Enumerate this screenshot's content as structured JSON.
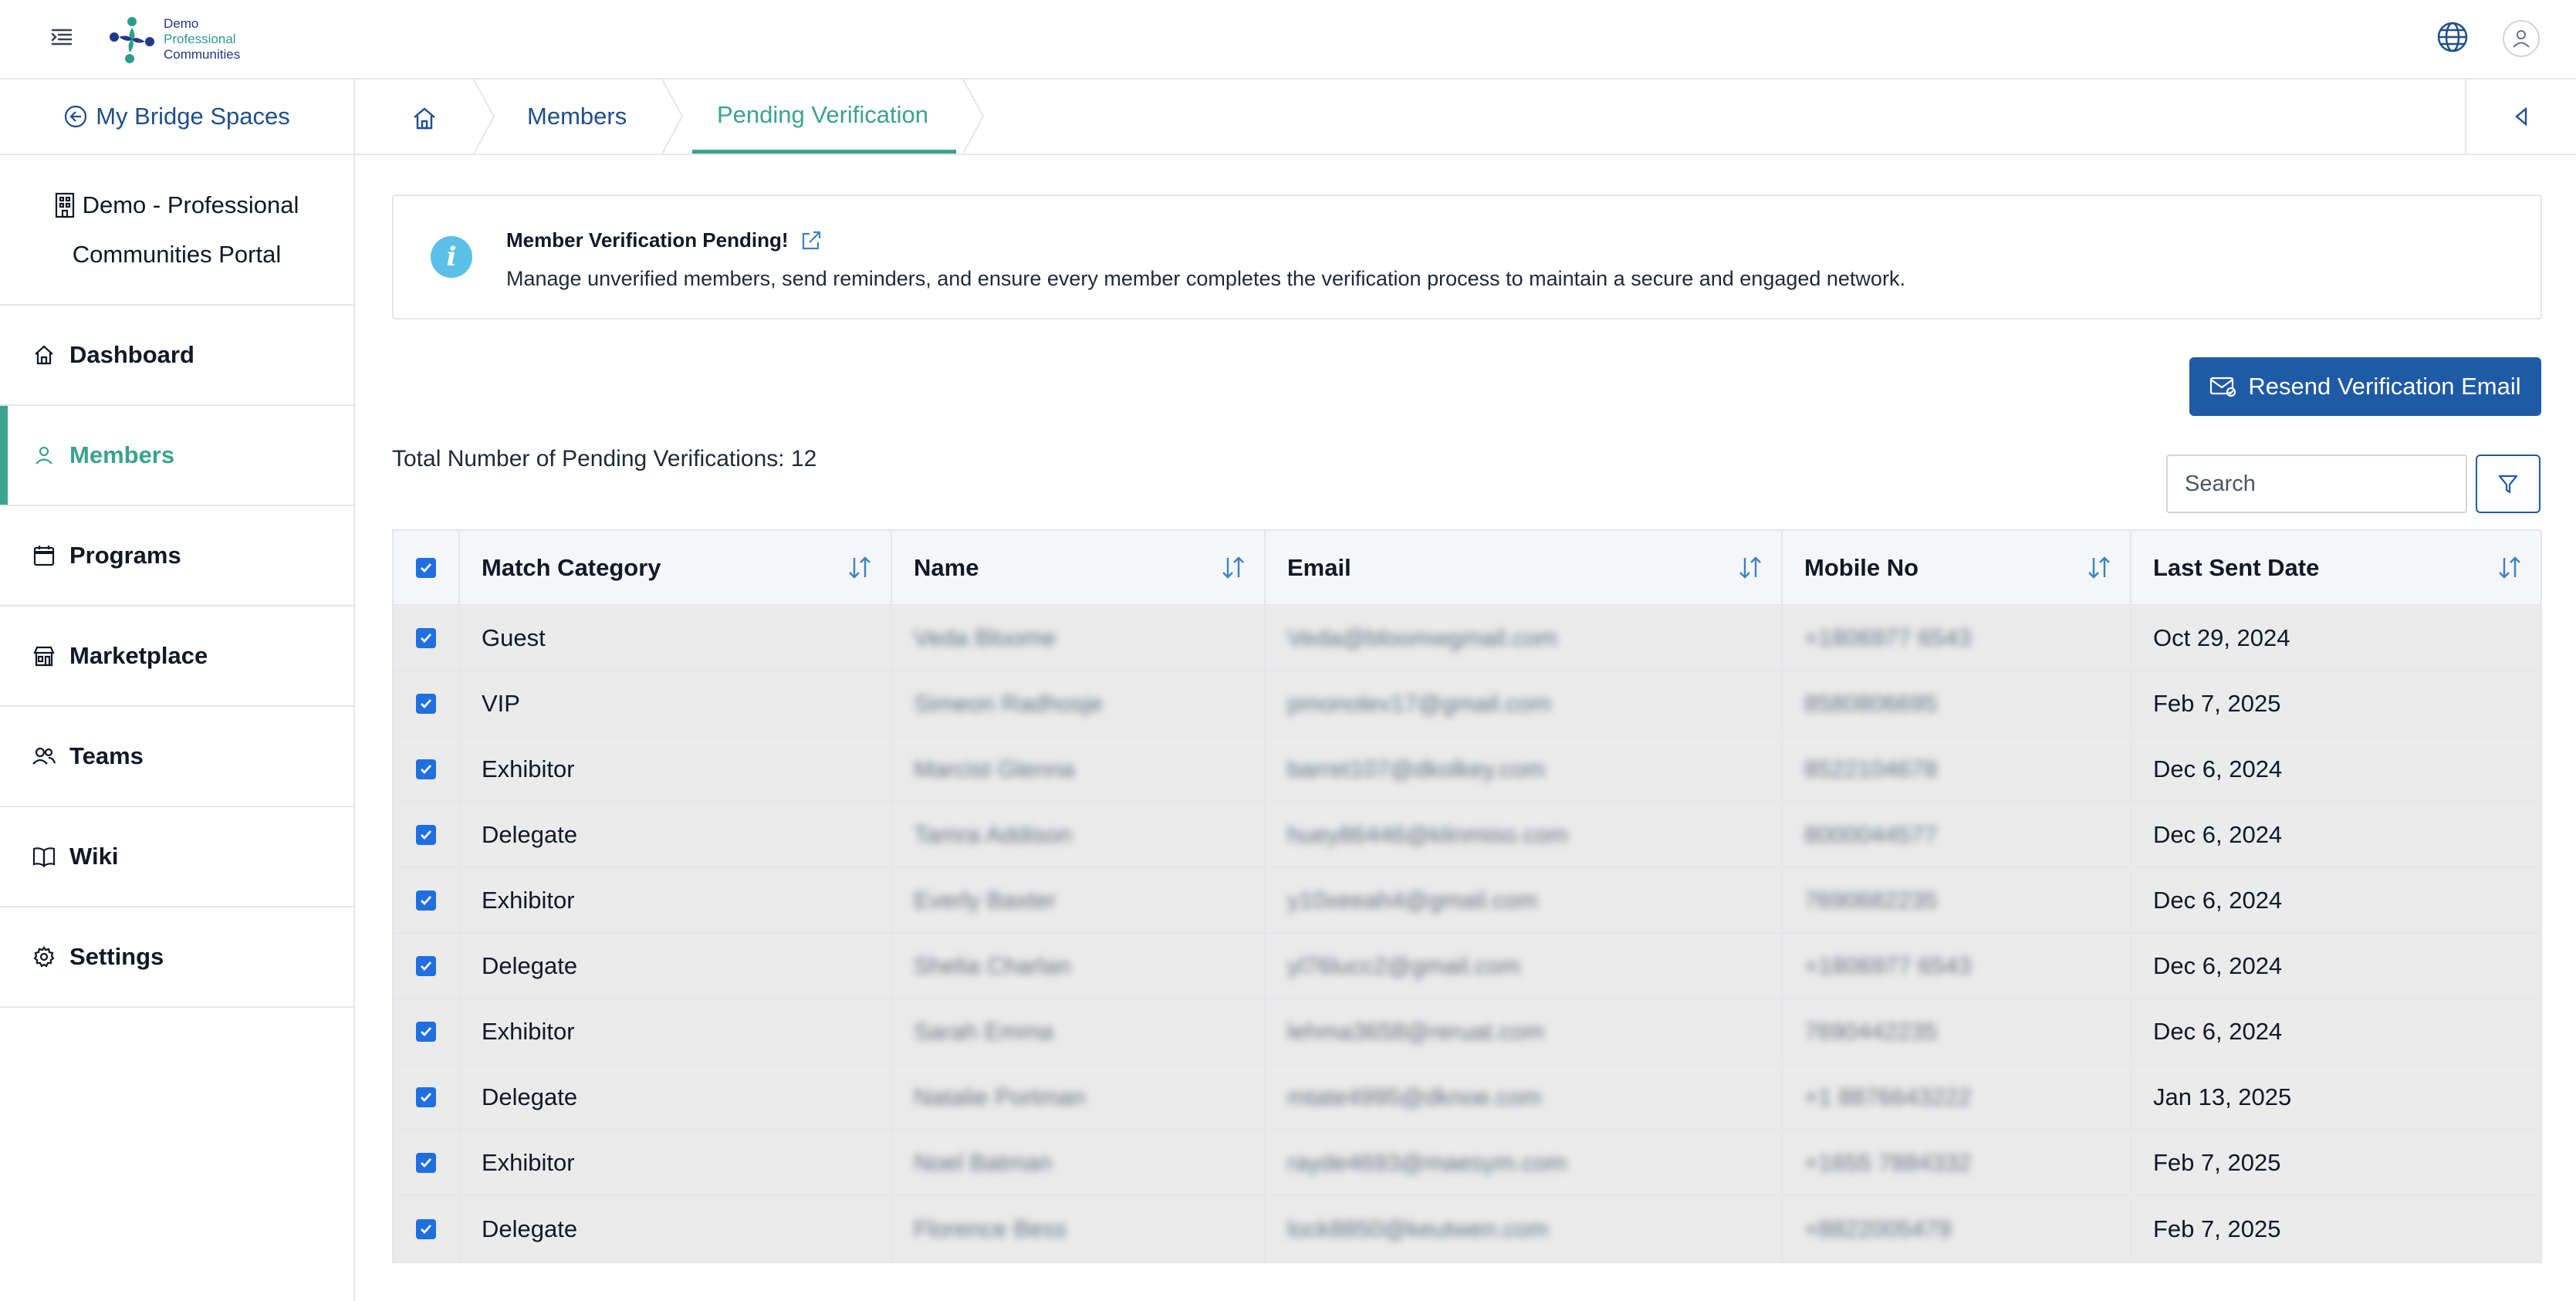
{
  "app": {
    "logo_lines": [
      "Demo",
      "Professional",
      "Communities"
    ]
  },
  "sidebar": {
    "back_label": "My Bridge Spaces",
    "portal_line1": "Demo - Professional",
    "portal_line2": "Communities Portal",
    "items": [
      {
        "label": "Dashboard",
        "icon": "home-icon"
      },
      {
        "label": "Members",
        "icon": "user-icon",
        "active": true
      },
      {
        "label": "Programs",
        "icon": "calendar-icon"
      },
      {
        "label": "Marketplace",
        "icon": "store-icon"
      },
      {
        "label": "Teams",
        "icon": "users-icon"
      },
      {
        "label": "Wiki",
        "icon": "book-icon"
      },
      {
        "label": "Settings",
        "icon": "gear-icon"
      }
    ]
  },
  "breadcrumb": {
    "items": [
      "Members",
      "Pending Verification"
    ]
  },
  "info": {
    "title": "Member Verification Pending!",
    "description": "Manage unverified members, send reminders, and ensure every member completes the verification process to maintain a secure and engaged network."
  },
  "actions": {
    "resend_label": "Resend Verification Email"
  },
  "summary": {
    "total_label": "Total Number of Pending Verifications: 12"
  },
  "search": {
    "placeholder": "Search"
  },
  "table": {
    "columns": [
      "Match Category",
      "Name",
      "Email",
      "Mobile No",
      "Last Sent Date"
    ],
    "rows": [
      {
        "category": "Guest",
        "name": "Veda Bloome",
        "email": "Veda@bloomwgmail.com",
        "mobile": "+1806977 6543",
        "date": "Oct 29, 2024"
      },
      {
        "category": "VIP",
        "name": "Simeon Radhosje",
        "email": "pmonolev17@gmail.com",
        "mobile": "8580806695",
        "date": "Feb 7, 2025"
      },
      {
        "category": "Exhibitor",
        "name": "Marcist Glenna",
        "email": "barret107@dkolkey.com",
        "mobile": "8522104678",
        "date": "Dec 6, 2024"
      },
      {
        "category": "Delegate",
        "name": "Tamra Addison",
        "email": "huey86446@klinmiso.com",
        "mobile": "8000044577",
        "date": "Dec 6, 2024"
      },
      {
        "category": "Exhibitor",
        "name": "Everly Baxter",
        "email": "y10xeeah4@gmail.com",
        "mobile": "7690682235",
        "date": "Dec 6, 2024"
      },
      {
        "category": "Delegate",
        "name": "Shelia Charlan",
        "email": "yl76lucc2@gmail.com",
        "mobile": "+1806977 6543",
        "date": "Dec 6, 2024"
      },
      {
        "category": "Exhibitor",
        "name": "Sarah Emma",
        "email": "lehma3658@reruat.com",
        "mobile": "7690442235",
        "date": "Dec 6, 2024"
      },
      {
        "category": "Delegate",
        "name": "Natalie Portman",
        "email": "mtate4995@dknoe.com",
        "mobile": "+1 8876643222",
        "date": "Jan 13, 2025"
      },
      {
        "category": "Exhibitor",
        "name": "Noel Batman",
        "email": "rayde4693@maesym.com",
        "mobile": "+1655 7884332",
        "date": "Feb 7, 2025"
      },
      {
        "category": "Delegate",
        "name": "Florence Bess",
        "email": "lock8850@keutwen.com",
        "mobile": "+8822005479",
        "date": "Feb 7, 2025"
      }
    ]
  },
  "colors": {
    "accent": "#3aa38f",
    "primary": "#1f5aa6",
    "link": "#1f4e8c",
    "checkbox": "#1f6fe0",
    "info": "#5bc0e8"
  }
}
